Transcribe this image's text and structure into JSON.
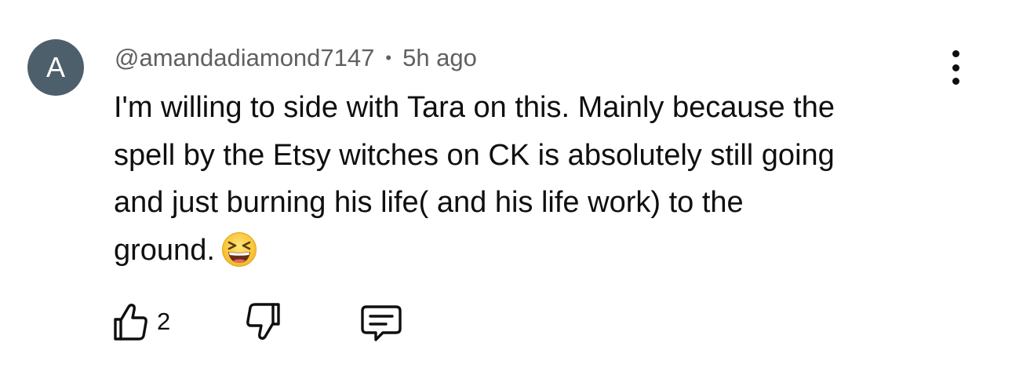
{
  "comment": {
    "avatar_letter": "A",
    "avatar_color": "#4e5f6c",
    "author": "@amandadiamond7147",
    "separator": "•",
    "time": "5h ago",
    "lines": [
      "I'm willing to side with Tara on this. Mainly because the",
      "spell by the Etsy witches on CK is absolutely still going",
      "and just burning his life( and his life work) to the",
      "ground."
    ],
    "emoji": "grinning-squinting-face-emoji",
    "like_count": "2",
    "icons": {
      "like": "thumbs-up-icon",
      "dislike": "thumbs-down-icon",
      "reply": "comment-reply-icon",
      "more": "more-vertical-icon"
    }
  }
}
